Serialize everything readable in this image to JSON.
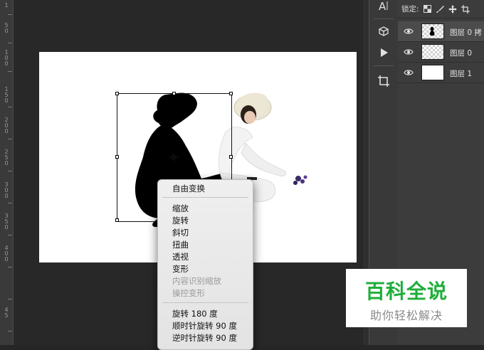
{
  "ruler": {
    "labels": [
      "1",
      "5",
      "0",
      "1",
      "0",
      "0",
      "1",
      "5",
      "0",
      "2",
      "0",
      "0",
      "2",
      "5",
      "0",
      "3",
      "0",
      "0",
      "3",
      "5",
      "0",
      "4",
      "0",
      "0",
      "4",
      "5"
    ]
  },
  "tools": [
    {
      "icon": "type-tool-icon"
    },
    {
      "icon": "3d-cube-icon"
    },
    {
      "icon": "play-icon"
    },
    {
      "icon": "crop-icon"
    }
  ],
  "layers_panel": {
    "lock_label": "锁定:",
    "layers": [
      {
        "name": "图层 0 拷",
        "selected": true,
        "thumb": "silhouette"
      },
      {
        "name": "图层 0",
        "selected": false,
        "thumb": "checker"
      },
      {
        "name": "图层 1",
        "selected": false,
        "thumb": "white"
      }
    ]
  },
  "context_menu": {
    "items": [
      {
        "label": "自由变换",
        "disabled": false
      },
      {
        "label": "缩放",
        "disabled": false
      },
      {
        "label": "旋转",
        "disabled": false
      },
      {
        "label": "斜切",
        "disabled": false
      },
      {
        "label": "扭曲",
        "disabled": false
      },
      {
        "label": "透视",
        "disabled": false
      },
      {
        "label": "变形",
        "disabled": false
      },
      {
        "label": "内容识别缩放",
        "disabled": true
      },
      {
        "label": "操控变形",
        "disabled": true
      },
      {
        "label": "旋转 180 度",
        "disabled": false
      },
      {
        "label": "顺时针旋转 90 度",
        "disabled": false
      },
      {
        "label": "逆时针旋转 90 度",
        "disabled": false
      }
    ]
  },
  "watermark": {
    "title": "百科全说",
    "subtitle": "助你轻松解决"
  },
  "colors": {
    "accent": "#1fae3b",
    "menu_bg": "#e9e9e9",
    "panel_bg": "#3c3c3c"
  }
}
